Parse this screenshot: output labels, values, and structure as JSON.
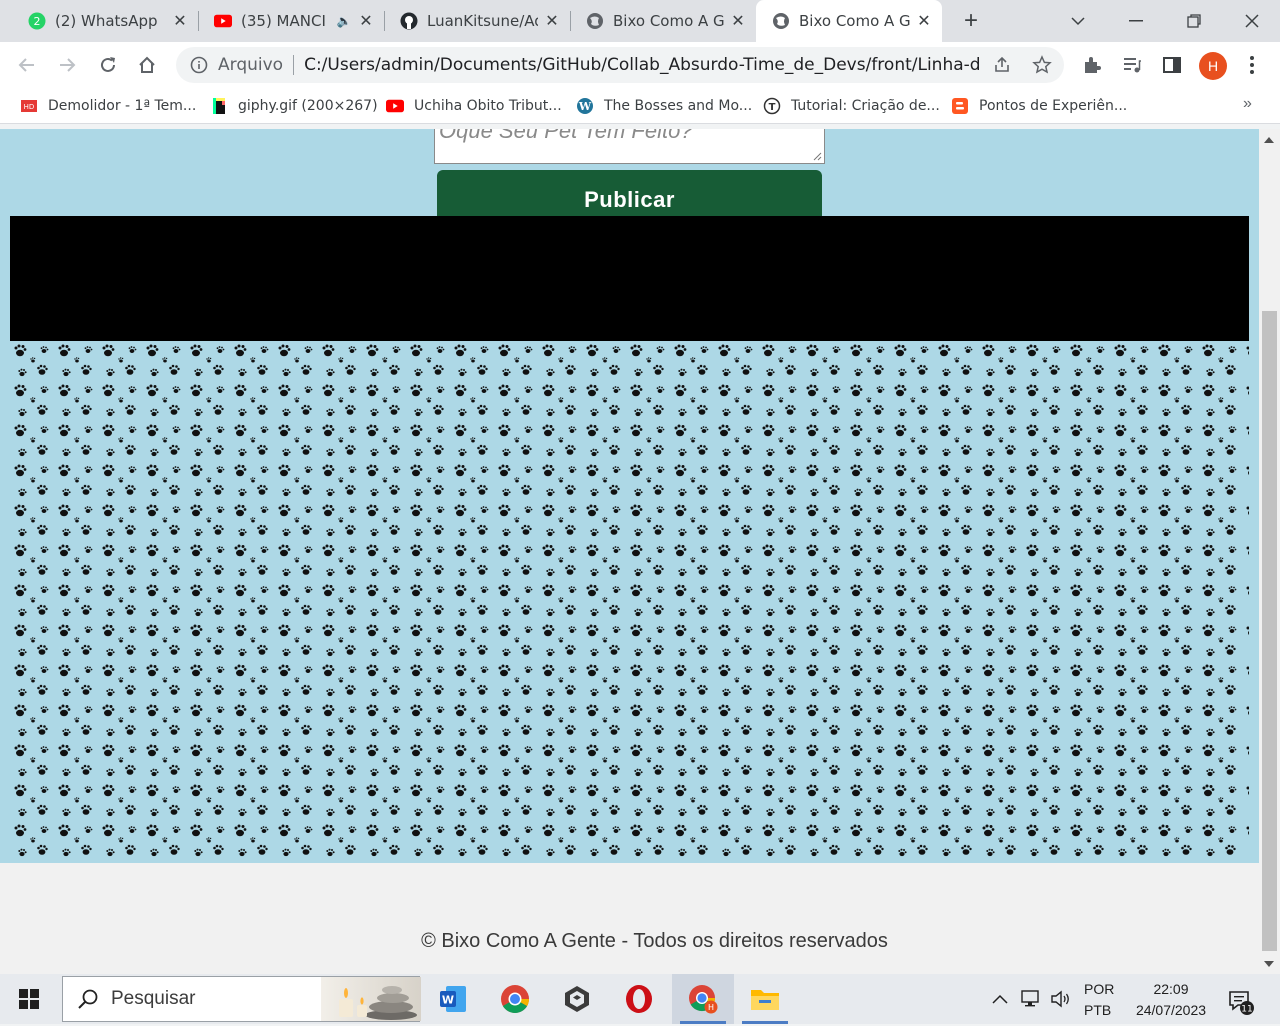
{
  "browser": {
    "tabs": [
      {
        "title": "(2) WhatsApp",
        "icon": "whatsapp-icon",
        "badge": "2"
      },
      {
        "title": "(35) MANCI",
        "icon": "youtube-icon"
      },
      {
        "title": "LuanKitsune/Ad",
        "icon": "github-icon"
      },
      {
        "title": "Bixo Como A Ge",
        "icon": "globe-icon"
      },
      {
        "title": "Bixo Como A Ge",
        "icon": "globe-icon",
        "active": true
      }
    ],
    "scheme_label": "Arquivo",
    "url": "C:/Users/admin/Documents/GitHub/Collab_Absurdo-Time_de_Devs/front/Linha-do-Te...",
    "profile_initial": "H",
    "bookmarks": [
      {
        "label": "Demolidor - 1ª Tem...",
        "icon": "hd-icon"
      },
      {
        "label": "giphy.gif (200×267)",
        "icon": "giphy-icon"
      },
      {
        "label": "Uchiha Obito Tribut...",
        "icon": "youtube-icon"
      },
      {
        "label": "The Bosses and Mo...",
        "icon": "wordpress-icon"
      },
      {
        "label": "Tutorial: Criação de...",
        "icon": "t-icon"
      },
      {
        "label": "Pontos de Experiên...",
        "icon": "blogger-icon"
      }
    ]
  },
  "page": {
    "textarea_placeholder": "Oque Seu Pet Tem Feito?",
    "publish_label": "Publicar",
    "footer_text": "© Bixo Como A Gente - Todos os direitos reservados"
  },
  "taskbar": {
    "search_placeholder": "Pesquisar",
    "lang_top": "POR",
    "lang_bottom": "PTB",
    "time": "22:09",
    "date": "24/07/2023",
    "notification_count": "11"
  },
  "colors": {
    "page_bg": "#add8e6",
    "publish_bg": "#175c36",
    "band": "#000000",
    "profile": "#e8501f"
  }
}
